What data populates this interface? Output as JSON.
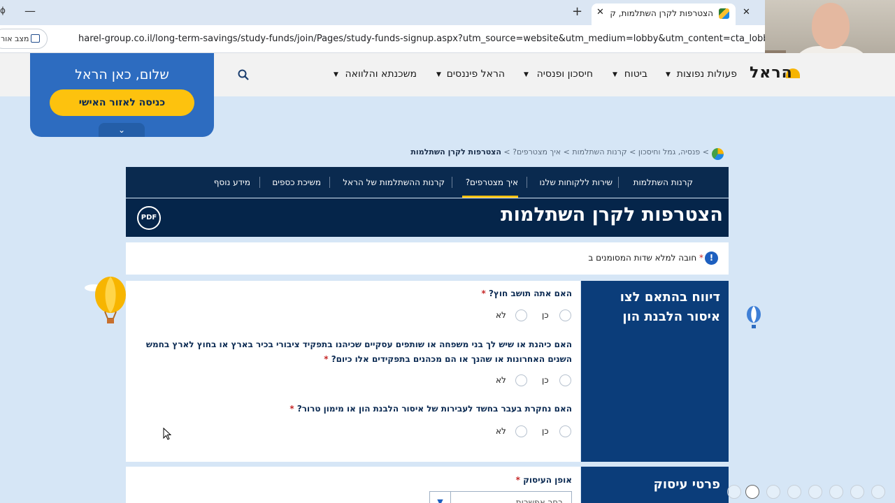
{
  "browser": {
    "active_tab_title": "הצטרפות לקרן השתלמות, קרנו",
    "url": "harel-group.co.il/long-term-savings/study-funds/join/Pages/study-funds-signup.aspx?utm_source=website&utm_medium=lobby&utm_content=cta_lobby&utm_campaign=kidom_s",
    "pill_label": "מצב אור",
    "new_tab": "+",
    "close": "✕",
    "minimize": "—"
  },
  "header": {
    "logo": "הראל",
    "nav": [
      "פעולות נפוצות",
      "ביטוח",
      "חיסכון ופנסיה",
      "הראל פיננסים",
      "משכנתא והלוואה"
    ],
    "greeting": "שלום, כאן הראל",
    "login_button": "כניסה לאזור האישי",
    "expand": "⌄"
  },
  "breadcrumb": {
    "items": "> פנסיה, גמל וחיסכון > קרנות השתלמות > איך מצטרפים? > ",
    "current": "הצטרפות לקרן השתלמות"
  },
  "subnav": [
    "קרנות השתלמות",
    "שירות ללקוחות שלנו",
    "איך מצטרפים?",
    "קרנות ההשתלמות של הראל",
    "משיכת כספים",
    "מידע נוסף"
  ],
  "subnav_active": "איך מצטרפים?",
  "page_title": "הצטרפות לקרן השתלמות",
  "pdf_label": "PDF",
  "required_note": {
    "text": "חובה למלא שדות המסומנים ב",
    "star": "*",
    "icon": "!"
  },
  "aml_section": {
    "title": "דיווח בהתאם לצו איסור הלבנת הון",
    "questions": [
      {
        "text": "האם אתה תושב חוץ?",
        "yes": "כן",
        "no": "לא"
      },
      {
        "text": "האם כיהנת או שיש לך בני משפחה או שותפים עסקיים שכיהנו בתפקיד ציבורי בכיר בארץ או בחוץ לארץ בחמש השנים האחרונות או שהנך או הם מכהנים בתפקידים אלו כיום?",
        "yes": "כן",
        "no": "לא"
      },
      {
        "text": "האם נחקרת בעבר בחשד לעבירות של איסור הלבנת הון או מימון טרור?",
        "yes": "כן",
        "no": "לא"
      }
    ]
  },
  "employment_section": {
    "title": "פרטי עיסוק",
    "field_label": "אופן העיסוק",
    "select_placeholder": "בחר אפשרות"
  },
  "colors": {
    "navy": "#05254a",
    "brand_blue": "#2d6cc0",
    "yellow": "#fdc20e",
    "background": "#d6e6f6"
  }
}
